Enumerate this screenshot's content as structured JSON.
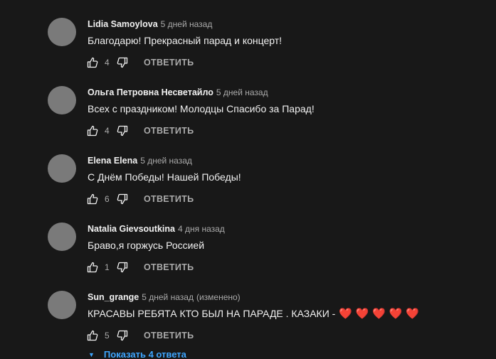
{
  "comments": [
    {
      "author": "Lidia Samoylova",
      "time": "5 дней назад",
      "edited": "",
      "text": "Благодарю! Прекрасный парад и концерт!",
      "likes": "4",
      "reply_label": "ОТВЕТИТЬ"
    },
    {
      "author": "Ольга Петровна Несветайло",
      "time": "5 дней назад",
      "edited": "",
      "text": "Всех с праздником! Молодцы Спасибо за Парад!",
      "likes": "4",
      "reply_label": "ОТВЕТИТЬ"
    },
    {
      "author": "Elena Elena",
      "time": "5 дней назад",
      "edited": "",
      "text": "С Днём Победы! Нашей Победы!",
      "likes": "6",
      "reply_label": "ОТВЕТИТЬ"
    },
    {
      "author": "Natalia Gievsoutkina",
      "time": "4 дня назад",
      "edited": "",
      "text": "Браво,я горжусь Россией",
      "likes": "1",
      "reply_label": "ОТВЕТИТЬ"
    },
    {
      "author": "Sun_grange",
      "time": "5 дней назад",
      "edited": "(изменено)",
      "text": "КРАСАВЫ РЕБЯТА КТО БЫЛ НА ПАРАДЕ . КАЗАКИ - ",
      "hearts": "❤️ ❤️ ❤️ ❤️ ❤️",
      "likes": "5",
      "reply_label": "ОТВЕТИТЬ"
    }
  ],
  "show_replies_label": "Показать 4 ответа",
  "icons": {
    "like": "thumb-up-icon",
    "dislike": "thumb-down-icon",
    "caret": "caret-down-icon"
  },
  "colors": {
    "background": "#181818",
    "avatar": "#7a7a7a",
    "link": "#3ea6ff",
    "heart": "#e8413f"
  }
}
